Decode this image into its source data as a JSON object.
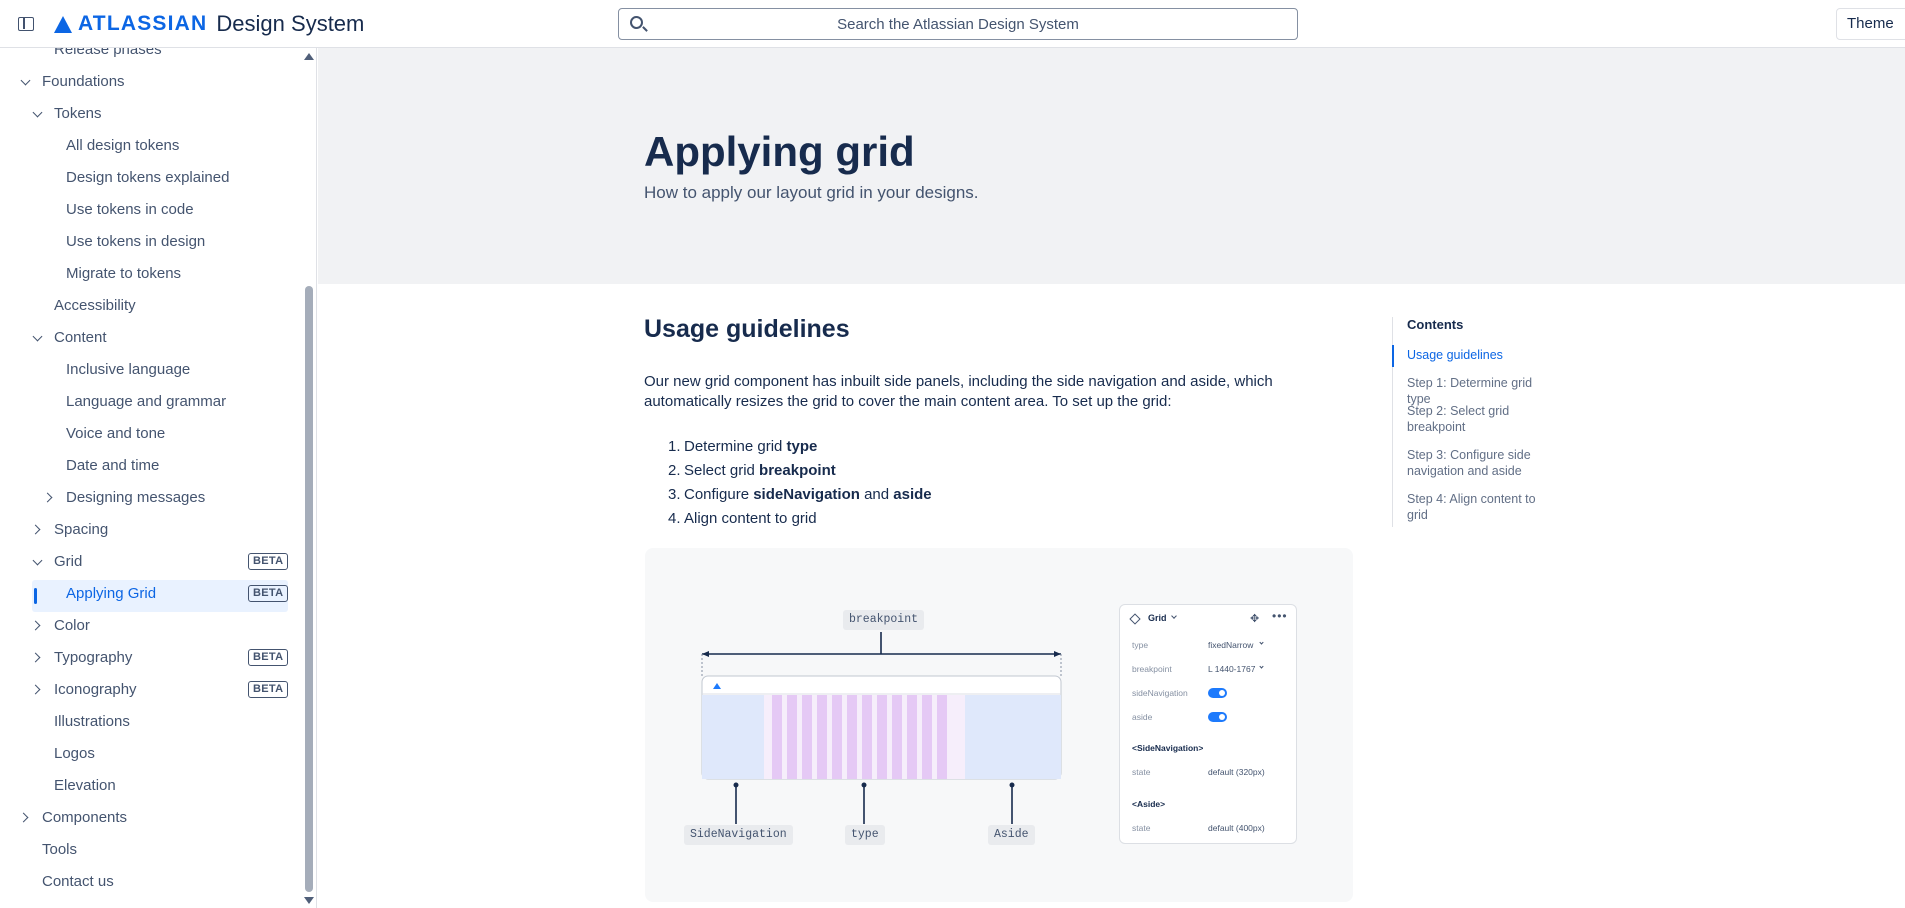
{
  "header": {
    "logo_word": "ATLASSIAN",
    "logo_sub": "Design System",
    "search_placeholder": "Search the Atlassian Design System",
    "theme_label": "Theme"
  },
  "sidebar": {
    "items": [
      {
        "label": "Release phases"
      },
      {
        "label": "Foundations"
      },
      {
        "label": "Tokens"
      },
      {
        "label": "All design tokens"
      },
      {
        "label": "Design tokens explained"
      },
      {
        "label": "Use tokens in code"
      },
      {
        "label": "Use tokens in design"
      },
      {
        "label": "Migrate to tokens"
      },
      {
        "label": "Accessibility"
      },
      {
        "label": "Content"
      },
      {
        "label": "Inclusive language"
      },
      {
        "label": "Language and grammar"
      },
      {
        "label": "Voice and tone"
      },
      {
        "label": "Date and time"
      },
      {
        "label": "Designing messages"
      },
      {
        "label": "Spacing"
      },
      {
        "label": "Grid",
        "badge": "BETA"
      },
      {
        "label": "Applying Grid",
        "badge": "BETA",
        "selected": true
      },
      {
        "label": "Color"
      },
      {
        "label": "Typography",
        "badge": "BETA"
      },
      {
        "label": "Iconography",
        "badge": "BETA"
      },
      {
        "label": "Illustrations"
      },
      {
        "label": "Logos"
      },
      {
        "label": "Elevation"
      },
      {
        "label": "Components"
      },
      {
        "label": "Tools"
      },
      {
        "label": "Contact us"
      }
    ]
  },
  "page": {
    "title": "Applying grid",
    "subtitle": "How to apply our layout grid in your designs.",
    "section_title": "Usage guidelines",
    "intro": "Our new grid component has inbuilt side panels, including the side navigation and aside, which automatically resizes the grid to cover the main content area. To set up the grid:",
    "steps": [
      {
        "num": "1.",
        "pre": "Determine grid ",
        "b1": "type",
        "mid": "",
        "b2": ""
      },
      {
        "num": "2.",
        "pre": "Select grid ",
        "b1": "breakpoint",
        "mid": "",
        "b2": ""
      },
      {
        "num": "3.",
        "pre": "Configure ",
        "b1": "sideNavigation",
        "mid": " and ",
        "b2": "aside"
      },
      {
        "num": "4.",
        "pre": "Align content to grid",
        "b1": "",
        "mid": "",
        "b2": ""
      }
    ]
  },
  "toc": {
    "heading": "Contents",
    "items": [
      {
        "label": "Usage guidelines",
        "active": true
      },
      {
        "label": "Step 1: Determine grid type"
      },
      {
        "label": "Step 2: Select grid breakpoint"
      },
      {
        "label": "Step 3: Configure side navigation and aside"
      },
      {
        "label": "Step 4: Align content to grid"
      }
    ]
  },
  "figure": {
    "labels": {
      "breakpoint": "breakpoint",
      "side_navigation": "SideNavigation",
      "type": "type",
      "aside": "Aside"
    },
    "panel": {
      "title": "Grid",
      "rows": [
        {
          "label": "type",
          "value": "fixedNarrow"
        },
        {
          "label": "breakpoint",
          "value": "L 1440-1767"
        },
        {
          "label": "sideNavigation",
          "value": "on"
        },
        {
          "label": "aside",
          "value": "on"
        }
      ],
      "side_nav_heading": "<SideNavigation>",
      "side_nav_state_label": "state",
      "side_nav_state_value": "default (320px)",
      "aside_heading": "<Aside>",
      "aside_state_label": "state",
      "aside_state_value": "default (400px)"
    }
  },
  "colors": {
    "brand": "#0c66e4",
    "selected_bg": "#e9f2ff",
    "grid_column": "#e5c9f5",
    "side_panel": "#dfe8fb"
  }
}
